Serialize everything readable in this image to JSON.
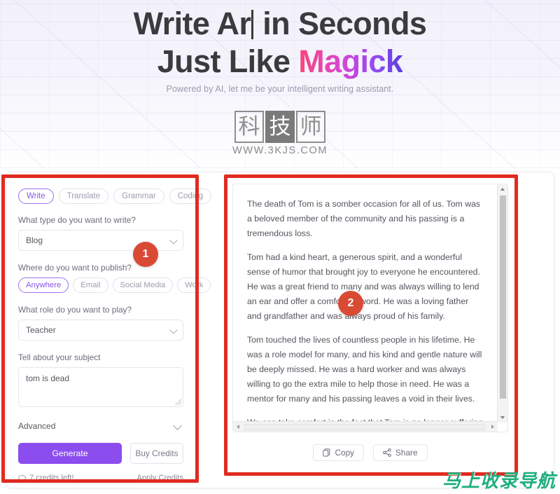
{
  "hero": {
    "headline_part1": "Write Ar",
    "headline_part2_prefix": "in Seconds",
    "headline_line2_prefix": "Just Like ",
    "headline_line2_accent": "Magick",
    "subhead": "Powered by AI, let me be your intelligent writing assistant.",
    "accent_gradient_start": "#f9467a",
    "accent_gradient_end": "#5b3ce0"
  },
  "logo": {
    "char1": "科",
    "char2": "技",
    "char3": "师",
    "url": "WWW.3KJS.COM"
  },
  "left_panel": {
    "tabs": [
      {
        "label": "Write",
        "active": true
      },
      {
        "label": "Translate",
        "active": false
      },
      {
        "label": "Grammar",
        "active": false
      },
      {
        "label": "Coding",
        "active": false
      }
    ],
    "type_question": "What type do you want to write?",
    "type_value": "Blog",
    "publish_question": "Where do you want to publish?",
    "publish_chips": [
      {
        "label": "Anywhere",
        "active": true
      },
      {
        "label": "Email",
        "active": false
      },
      {
        "label": "Social Media",
        "active": false
      },
      {
        "label": "Work",
        "active": false
      }
    ],
    "role_question": "What role do you want to play?",
    "role_value": "Teacher",
    "subject_label": "Tell about your subject",
    "subject_value": "tom is dead",
    "subject_placeholder": "Tell about your subject",
    "advanced_label": "Advanced",
    "generate_label": "Generate",
    "buy_credits_label": "Buy Credits",
    "credits_text": "7 credits left!",
    "apply_credits_label": "Apply Credits",
    "generate_color": "#8b4dee",
    "active_color": "#8757e8"
  },
  "right_panel": {
    "paragraphs": [
      "The death of Tom is a somber occasion for all of us. Tom was a beloved member of the community and his passing is a tremendous loss.",
      "Tom had a kind heart, a generous spirit, and a wonderful sense of humor that brought joy to everyone he encountered. He was a great friend to many and was always willing to lend an ear and offer a comforting word. He was a loving father and grandfather and was always proud of his family.",
      "Tom touched the lives of countless people in his lifetime. He was a role model for many, and his kind and gentle nature will be deeply missed. He was a hard worker and was always willing to go the extra mile to help those in need. He was a mentor for many and his passing leaves a void in their lives.",
      "We can take comfort in the fact that Tom is no longer suffering and is now in a better place. We should take solace in the fact that he is no longer in pain and can now rest peacefully."
    ],
    "copy_label": "Copy",
    "share_label": "Share"
  },
  "annotations": {
    "badge_1": "1",
    "badge_2": "2",
    "box_color": "#e02b20",
    "badge_color": "#d94a34"
  },
  "watermark": {
    "text": "马上收录导航",
    "color": "#1fae7e"
  }
}
